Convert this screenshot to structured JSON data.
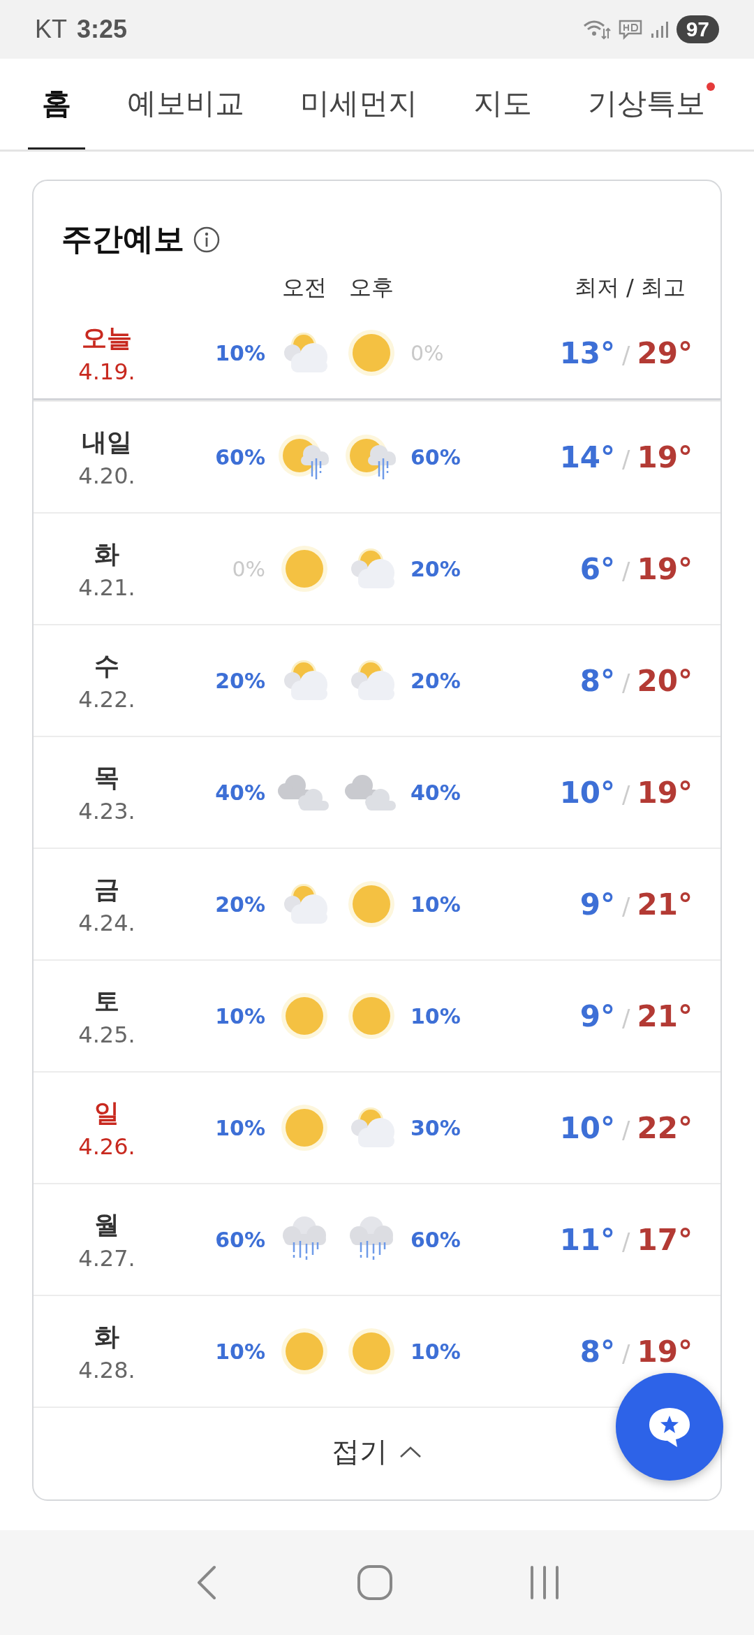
{
  "status_bar": {
    "carrier": "KT",
    "time": "3:25",
    "battery": "97"
  },
  "tabs": [
    {
      "label": "홈",
      "selected": true,
      "alert": false
    },
    {
      "label": "예보비교",
      "selected": false,
      "alert": false
    },
    {
      "label": "미세먼지",
      "selected": false,
      "alert": false
    },
    {
      "label": "지도",
      "selected": false,
      "alert": false
    },
    {
      "label": "기상특보",
      "selected": false,
      "alert": true
    }
  ],
  "weekly": {
    "title": "주간예보",
    "header": {
      "am": "오전",
      "pm": "오후",
      "temps": "최저 / 최고"
    },
    "today": {
      "day": "오늘",
      "date": "4.19.",
      "holiday": true,
      "am": {
        "kind": "partly_cloudy",
        "pop": "10%",
        "muted": false
      },
      "pm": {
        "kind": "sun",
        "pop": "0%",
        "muted": true
      },
      "low": "13°",
      "sep": "/",
      "high": "29°"
    },
    "days": [
      {
        "day": "내일",
        "date": "4.20.",
        "holiday": false,
        "am": {
          "kind": "sun_rain",
          "pop": "60%",
          "muted": false
        },
        "pm": {
          "kind": "sun_rain",
          "pop": "60%",
          "muted": false
        },
        "low": "14°",
        "sep": "/",
        "high": "19°"
      },
      {
        "day": "화",
        "date": "4.21.",
        "holiday": false,
        "am": {
          "kind": "sun",
          "pop": "0%",
          "muted": true
        },
        "pm": {
          "kind": "partly_cloudy",
          "pop": "20%",
          "muted": false
        },
        "low": "6°",
        "sep": "/",
        "high": "19°"
      },
      {
        "day": "수",
        "date": "4.22.",
        "holiday": false,
        "am": {
          "kind": "partly_cloudy",
          "pop": "20%",
          "muted": false
        },
        "pm": {
          "kind": "partly_cloudy",
          "pop": "20%",
          "muted": false
        },
        "low": "8°",
        "sep": "/",
        "high": "20°"
      },
      {
        "day": "목",
        "date": "4.23.",
        "holiday": false,
        "am": {
          "kind": "cloudy",
          "pop": "40%",
          "muted": false
        },
        "pm": {
          "kind": "cloudy",
          "pop": "40%",
          "muted": false
        },
        "low": "10°",
        "sep": "/",
        "high": "19°"
      },
      {
        "day": "금",
        "date": "4.24.",
        "holiday": false,
        "am": {
          "kind": "partly_cloudy",
          "pop": "20%",
          "muted": false
        },
        "pm": {
          "kind": "sun",
          "pop": "10%",
          "muted": false
        },
        "low": "9°",
        "sep": "/",
        "high": "21°"
      },
      {
        "day": "토",
        "date": "4.25.",
        "holiday": false,
        "am": {
          "kind": "sun",
          "pop": "10%",
          "muted": false
        },
        "pm": {
          "kind": "sun",
          "pop": "10%",
          "muted": false
        },
        "low": "9°",
        "sep": "/",
        "high": "21°"
      },
      {
        "day": "일",
        "date": "4.26.",
        "holiday": true,
        "am": {
          "kind": "sun",
          "pop": "10%",
          "muted": false
        },
        "pm": {
          "kind": "partly_cloudy",
          "pop": "30%",
          "muted": false
        },
        "low": "10°",
        "sep": "/",
        "high": "22°"
      },
      {
        "day": "월",
        "date": "4.27.",
        "holiday": false,
        "am": {
          "kind": "rain",
          "pop": "60%",
          "muted": false
        },
        "pm": {
          "kind": "rain",
          "pop": "60%",
          "muted": false
        },
        "low": "11°",
        "sep": "/",
        "high": "17°"
      },
      {
        "day": "화",
        "date": "4.28.",
        "holiday": false,
        "am": {
          "kind": "sun",
          "pop": "10%",
          "muted": false
        },
        "pm": {
          "kind": "sun",
          "pop": "10%",
          "muted": false
        },
        "low": "8°",
        "sep": "/",
        "high": "19°"
      }
    ],
    "fold_button": "접기"
  }
}
